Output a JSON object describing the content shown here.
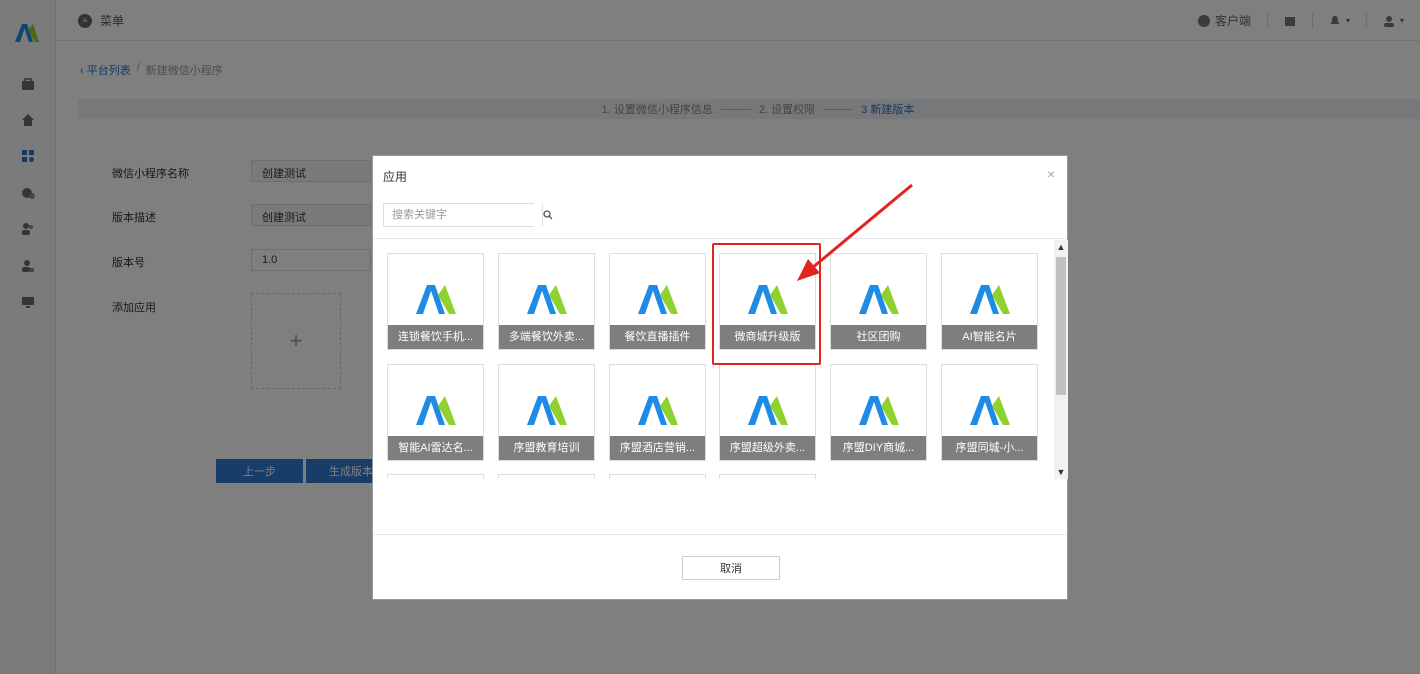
{
  "topbar": {
    "menu_label": "菜单",
    "client_label": "客户端"
  },
  "breadcrumb": {
    "parent": "平台列表",
    "separator": "/",
    "current": "新建微信小程序"
  },
  "steps": [
    {
      "label": "1. 设置微信小程序信息",
      "active": false
    },
    {
      "label": "2. 设置权限",
      "active": false
    },
    {
      "label": "3 新建版本",
      "active": true
    }
  ],
  "form": {
    "name_label": "微信小程序名称",
    "name_value": "创建测试",
    "desc_label": "版本描述",
    "desc_value": "创建测试",
    "version_label": "版本号",
    "version_value": "1.0",
    "add_app_label": "添加应用",
    "add_symbol": "+"
  },
  "buttons": {
    "prev": "上一步",
    "generate": "生成版本"
  },
  "modal": {
    "title": "应用",
    "close": "×",
    "search_placeholder": "搜索关键字",
    "cancel": "取消",
    "scroll_up": "▲",
    "scroll_down": "▼"
  },
  "apps": [
    "连锁餐饮手机...",
    "多端餐饮外卖...",
    "餐饮直播插件",
    "微商城升级版",
    "社区团购",
    "AI智能名片",
    "智能AI雷达名...",
    "序盟教育培训",
    "序盟酒店营销...",
    "序盟超级外卖...",
    "序盟DIY商城...",
    "序盟同城-小..."
  ],
  "colors": {
    "accent": "#2b74c7",
    "highlight": "#e0251f",
    "logo_blue": "#1e8be6",
    "logo_green": "#8fd12f"
  }
}
